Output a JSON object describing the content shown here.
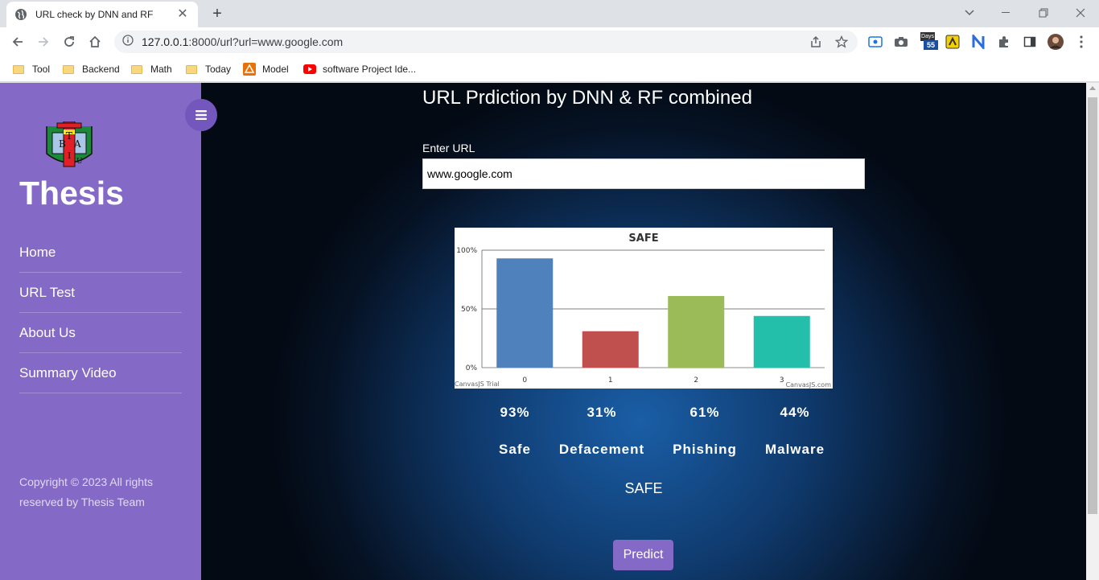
{
  "browser": {
    "tab_title": "URL check by DNN and RF",
    "url_prefix": "127.0.0.1",
    "url_rest": ":8000/url?url=www.google.com",
    "bookmarks": [
      "Tool",
      "Backend",
      "Math",
      "Today",
      "Model",
      "software Project Ide..."
    ],
    "ext_badge": "55",
    "ext_days": "Days"
  },
  "sidebar": {
    "brand": "Thesis",
    "logo_letters": [
      "B",
      "T",
      "A",
      "I",
      "U"
    ],
    "menu": [
      "Home",
      "URL Test",
      "About Us",
      "Summary Video"
    ],
    "copyright": "Copyright © 2023 All rights reserved by Thesis Team"
  },
  "main": {
    "heading": "URL Prdiction by DNN & RF combined",
    "input_label": "Enter URL",
    "input_value": "www.google.com",
    "result": "SAFE",
    "predict_label": "Predict",
    "percentages": [
      "93%",
      "31%",
      "61%",
      "44%"
    ],
    "categories": [
      "Safe",
      "Defacement",
      "Phishing",
      "Malware"
    ]
  },
  "chart_data": {
    "type": "bar",
    "title": "SAFE",
    "categories": [
      "0",
      "1",
      "2",
      "3"
    ],
    "values": [
      93,
      31,
      61,
      44
    ],
    "colors": [
      "#4f81bc",
      "#c0504e",
      "#9bbb58",
      "#23bfaa"
    ],
    "yticks": [
      "0%",
      "50%",
      "100%"
    ],
    "ylim": [
      0,
      100
    ],
    "grid": true,
    "credit_left": "CanvasJS Trial",
    "credit_right": "CanvasJS.com"
  }
}
